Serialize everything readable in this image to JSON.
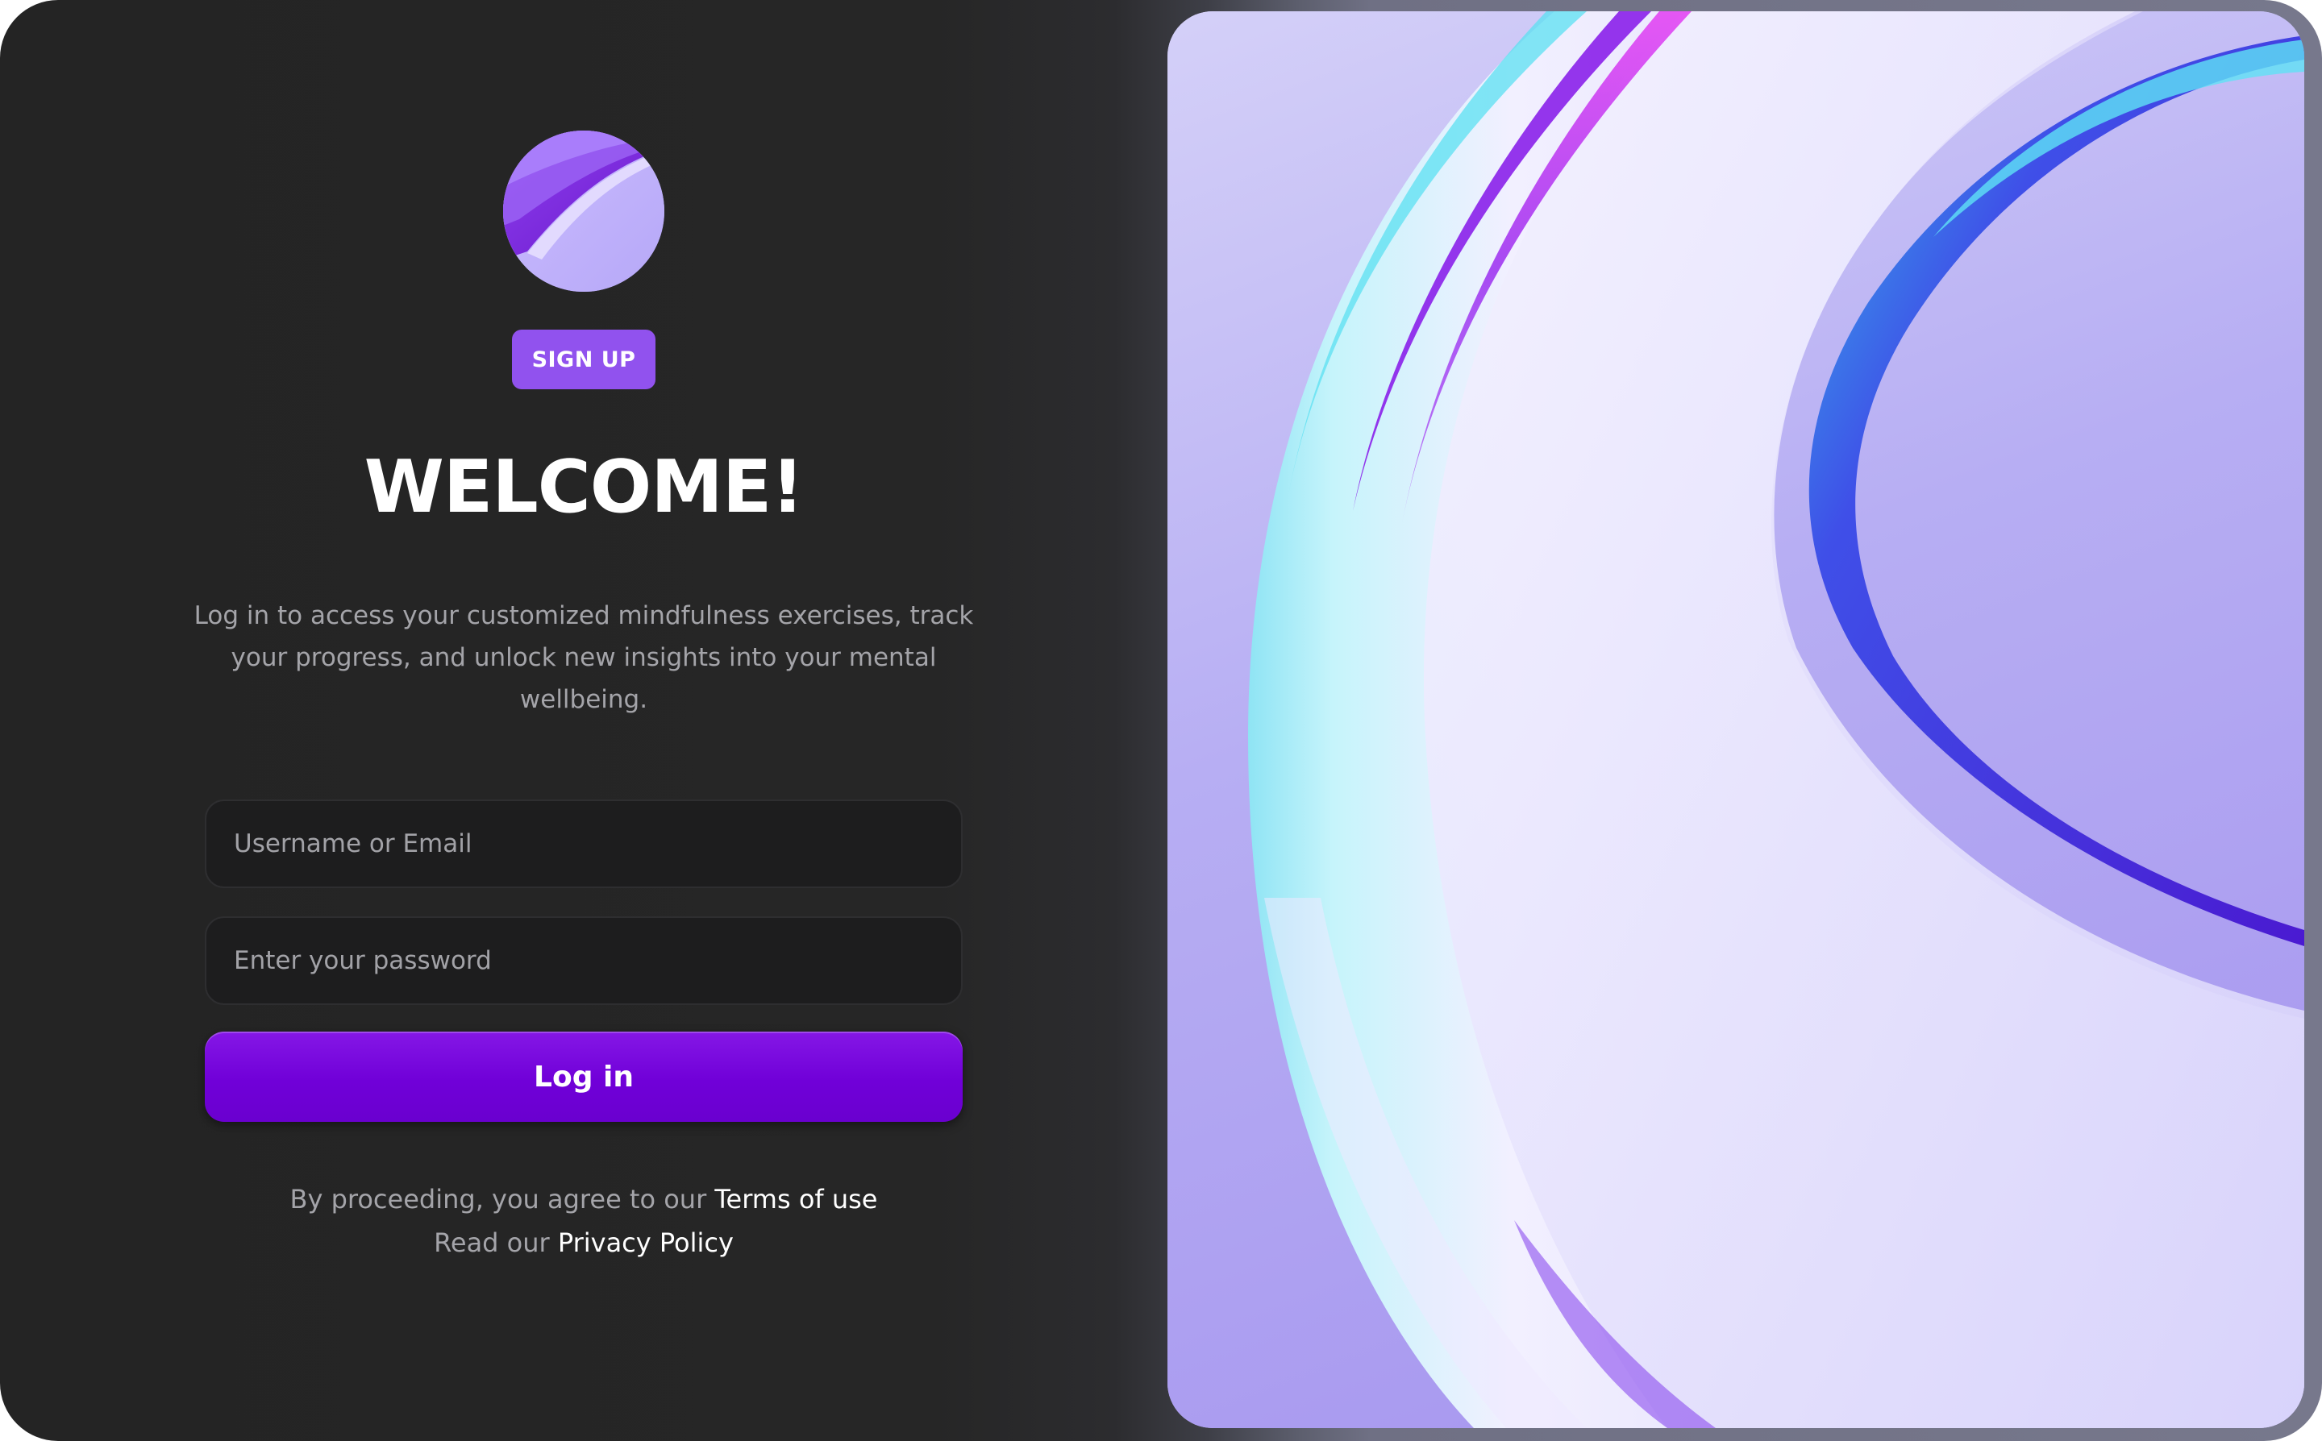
{
  "colors": {
    "panel_background": "#242424",
    "accent_purple": "#9152ee",
    "login_button": "#7000d8",
    "field_background": "#1d1d1e",
    "muted_text": "#a4a4a9",
    "link_text": "#ffffff"
  },
  "header": {
    "logo_icon": "abstract-purple-wave-logo",
    "signup_label": "SIGN UP",
    "title": "WELCOME!",
    "intro": "Log in to access your customized mindfulness exercises, track your progress, and unlock new insights into your mental wellbeing."
  },
  "form": {
    "username_placeholder": "Username or Email",
    "password_placeholder": "Enter your password",
    "login_label": "Log in"
  },
  "legal": {
    "terms_prefix": "By proceeding, you agree to our",
    "terms_link": "Terms of use",
    "privacy_prefix": "Read our",
    "privacy_link": "Privacy Policy"
  },
  "hero": {
    "image_icon": "abstract-iridescent-glass-ribbons"
  }
}
